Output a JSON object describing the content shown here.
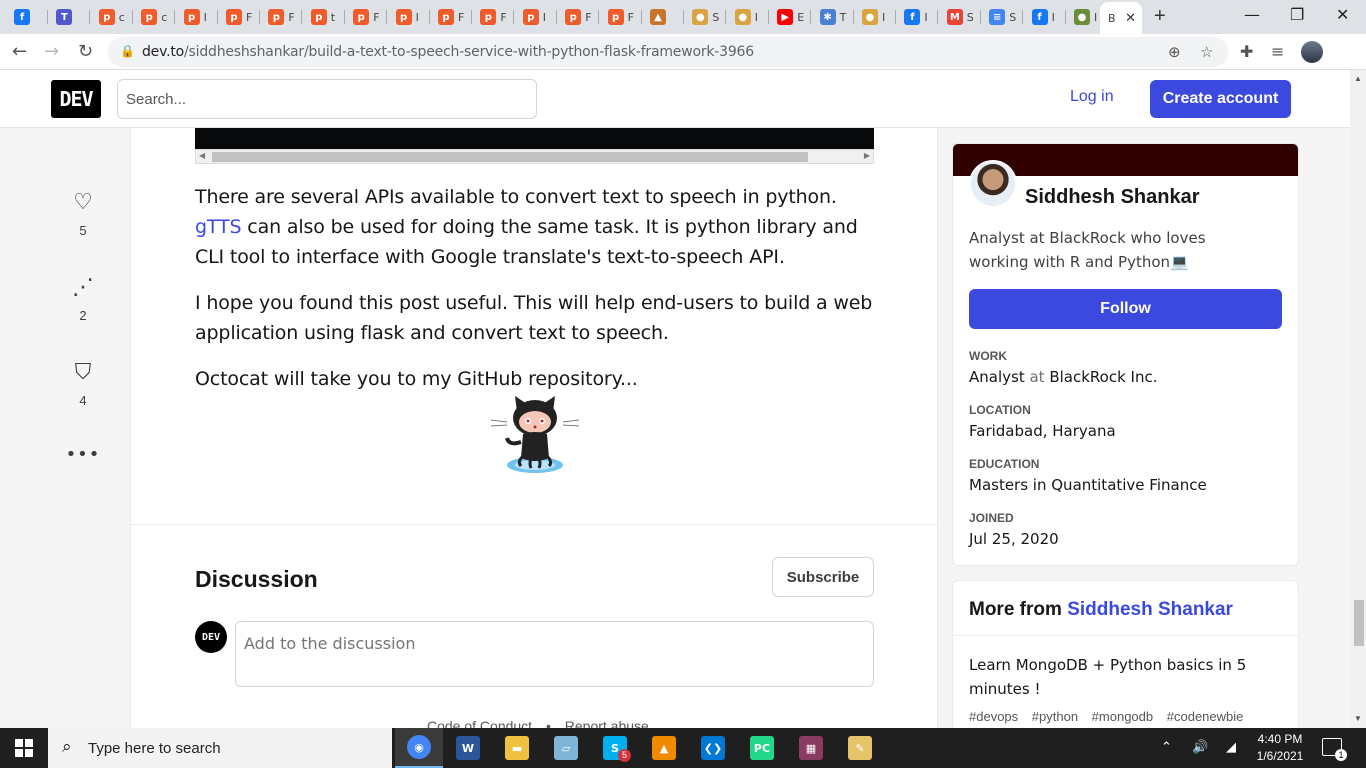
{
  "browser": {
    "tabs": [
      {
        "icon": "facebook-icon",
        "glyph": "f",
        "color": "#1877f2",
        "letter": ""
      },
      {
        "icon": "teams-icon",
        "glyph": "T",
        "color": "#5059c9",
        "letter": ""
      },
      {
        "icon": "pocket-icon",
        "glyph": "p",
        "color": "#ef5b2b",
        "letter": "c"
      },
      {
        "icon": "pocket-icon",
        "glyph": "p",
        "color": "#ef5b2b",
        "letter": "c"
      },
      {
        "icon": "pocket-icon",
        "glyph": "p",
        "color": "#ef5b2b",
        "letter": "I"
      },
      {
        "icon": "pocket-icon",
        "glyph": "p",
        "color": "#ef5b2b",
        "letter": "F"
      },
      {
        "icon": "pocket-icon",
        "glyph": "p",
        "color": "#ef5b2b",
        "letter": "F"
      },
      {
        "icon": "pocket-icon",
        "glyph": "p",
        "color": "#ef5b2b",
        "letter": "t"
      },
      {
        "icon": "pocket-icon",
        "glyph": "p",
        "color": "#ef5b2b",
        "letter": "F"
      },
      {
        "icon": "pocket-icon",
        "glyph": "p",
        "color": "#ef5b2b",
        "letter": "I"
      },
      {
        "icon": "pocket-icon",
        "glyph": "p",
        "color": "#ef5b2b",
        "letter": "F"
      },
      {
        "icon": "pocket-icon",
        "glyph": "p",
        "color": "#ef5b2b",
        "letter": "F"
      },
      {
        "icon": "pocket-icon",
        "glyph": "p",
        "color": "#ef5b2b",
        "letter": "I"
      },
      {
        "icon": "pocket-icon",
        "glyph": "p",
        "color": "#ef5b2b",
        "letter": "F"
      },
      {
        "icon": "pocket-icon",
        "glyph": "p",
        "color": "#ef5b2b",
        "letter": "F"
      },
      {
        "icon": "pma-icon",
        "glyph": "▲",
        "color": "#c8742a",
        "letter": ""
      },
      {
        "icon": "colab-icon",
        "glyph": "●",
        "color": "#d9a441",
        "letter": "S"
      },
      {
        "icon": "colab-icon",
        "glyph": "●",
        "color": "#d9a441",
        "letter": "I"
      },
      {
        "icon": "youtube-icon",
        "glyph": "▶",
        "color": "#ff0000",
        "letter": "E"
      },
      {
        "icon": "network-icon",
        "glyph": "✱",
        "color": "#4a7fd4",
        "letter": "T"
      },
      {
        "icon": "colab-icon",
        "glyph": "●",
        "color": "#d9a441",
        "letter": "I"
      },
      {
        "icon": "facebook-icon",
        "glyph": "f",
        "color": "#1877f2",
        "letter": "I"
      },
      {
        "icon": "gmail-icon",
        "glyph": "M",
        "color": "#ea4335",
        "letter": "S"
      },
      {
        "icon": "docs-icon",
        "glyph": "≡",
        "color": "#4285f4",
        "letter": "S"
      },
      {
        "icon": "facebook-icon",
        "glyph": "f",
        "color": "#1877f2",
        "letter": "I"
      },
      {
        "icon": "animal-icon",
        "glyph": "●",
        "color": "#6b8e3a",
        "letter": "I"
      }
    ],
    "active_tab_letter": "B",
    "url_host": "dev.to",
    "url_path": "/siddheshshankar/build-a-text-to-speech-service-with-python-flask-framework-3966"
  },
  "header": {
    "logo": "DEV",
    "search_placeholder": "Search...",
    "login": "Log in",
    "create_account": "Create account"
  },
  "reactions": [
    {
      "icon": "heart-icon",
      "glyph": "♡",
      "count": "5"
    },
    {
      "icon": "unicorn-icon",
      "glyph": "⋰",
      "count": "2"
    },
    {
      "icon": "bookmark-icon",
      "glyph": "⛉",
      "count": "4"
    }
  ],
  "article": {
    "para1_before": "There are several APIs available to convert text to speech in python. ",
    "para1_link": "gTTS",
    "para1_after": " can also be used for doing the same task. It is python library and CLI tool to interface with Google translate's text-to-speech API.",
    "para2": "I hope you found this post useful. This will help end-users to build a web application using flask and convert text to speech.",
    "para3": "Octocat will take you to my GitHub repository...",
    "discussion_title": "Discussion",
    "subscribe": "Subscribe",
    "comment_avatar": "DEV",
    "comment_placeholder": "Add to the discussion",
    "footer_code": "Code of Conduct",
    "footer_dot": "•",
    "footer_report": "Report abuse"
  },
  "profile": {
    "name": "Siddhesh Shankar",
    "bio": "Analyst at BlackRock who loves working with R and Python💻",
    "follow": "Follow",
    "work_label": "WORK",
    "work_role": "Analyst",
    "work_at": "at",
    "work_org": "BlackRock Inc.",
    "location_label": "LOCATION",
    "location": "Faridabad, Haryana",
    "education_label": "EDUCATION",
    "education": "Masters in Quantitative Finance",
    "joined_label": "JOINED",
    "joined": "Jul 25, 2020"
  },
  "more_from": {
    "prefix": "More from ",
    "author": "Siddhesh Shankar",
    "post_title": "Learn MongoDB + Python basics in 5 minutes !",
    "tags": [
      "#devops",
      "#python",
      "#mongodb",
      "#codenewbie"
    ]
  },
  "taskbar": {
    "search_text": "Type here to search",
    "apps": [
      {
        "icon": "chrome-icon",
        "color": "#4285f4",
        "glyph": "◉"
      },
      {
        "icon": "word-icon",
        "color": "#2b579a",
        "glyph": "W"
      },
      {
        "icon": "file-explorer-icon",
        "color": "#f0c040",
        "glyph": "▬"
      },
      {
        "icon": "notepad-icon",
        "color": "#7fb5d6",
        "glyph": "▱"
      },
      {
        "icon": "skype-icon",
        "color": "#00aff0",
        "glyph": "S"
      },
      {
        "icon": "vlc-icon",
        "color": "#f08a00",
        "glyph": "▲"
      },
      {
        "icon": "vscode-icon",
        "color": "#0078d4",
        "glyph": "❮❯"
      },
      {
        "icon": "pycharm-icon",
        "color": "#21d789",
        "glyph": "PC"
      },
      {
        "icon": "winrar-icon",
        "color": "#8b3a62",
        "glyph": "▦"
      },
      {
        "icon": "paint-icon",
        "color": "#e6c36a",
        "glyph": "✎"
      }
    ],
    "skype_badge": "5",
    "time": "4:40 PM",
    "date": "1/6/2021",
    "notification_count": "1"
  }
}
